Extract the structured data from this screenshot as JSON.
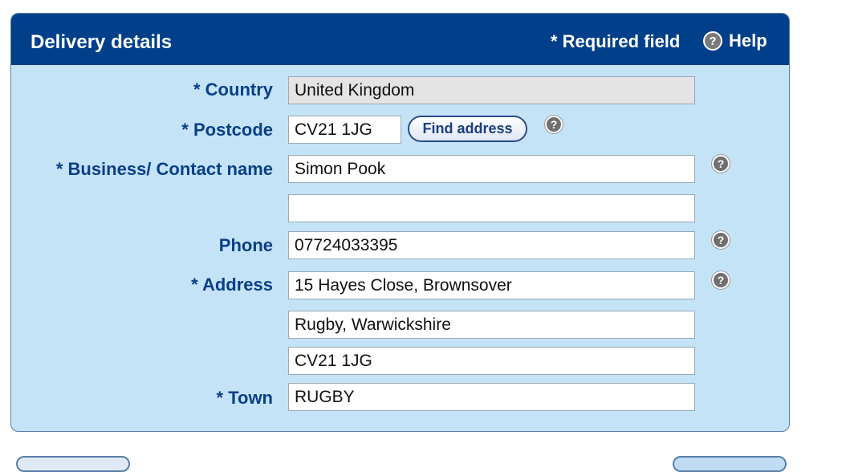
{
  "header": {
    "title": "Delivery details",
    "required_note": "* Required field",
    "help_label": "Help",
    "help_glyph": "?"
  },
  "form": {
    "country": {
      "label": "* Country",
      "value": "United Kingdom"
    },
    "postcode": {
      "label": "* Postcode",
      "value": "CV21 1JG",
      "find_button": "Find address"
    },
    "business_name": {
      "label": "* Business/ Contact name",
      "value": "Simon Pook",
      "value2": ""
    },
    "phone": {
      "label": "Phone",
      "value": "07724033395"
    },
    "address": {
      "label": "* Address",
      "line1": "15 Hayes Close, Brownsover",
      "line2": "Rugby, Warwickshire",
      "line3": "CV21 1JG"
    },
    "town": {
      "label": "* Town",
      "value": "RUGBY"
    }
  },
  "icons": {
    "help_glyph": "?"
  },
  "colors": {
    "header_bg": "#003f8a",
    "panel_bg": "#c4e3f7",
    "label_text": "#0a3f86"
  }
}
